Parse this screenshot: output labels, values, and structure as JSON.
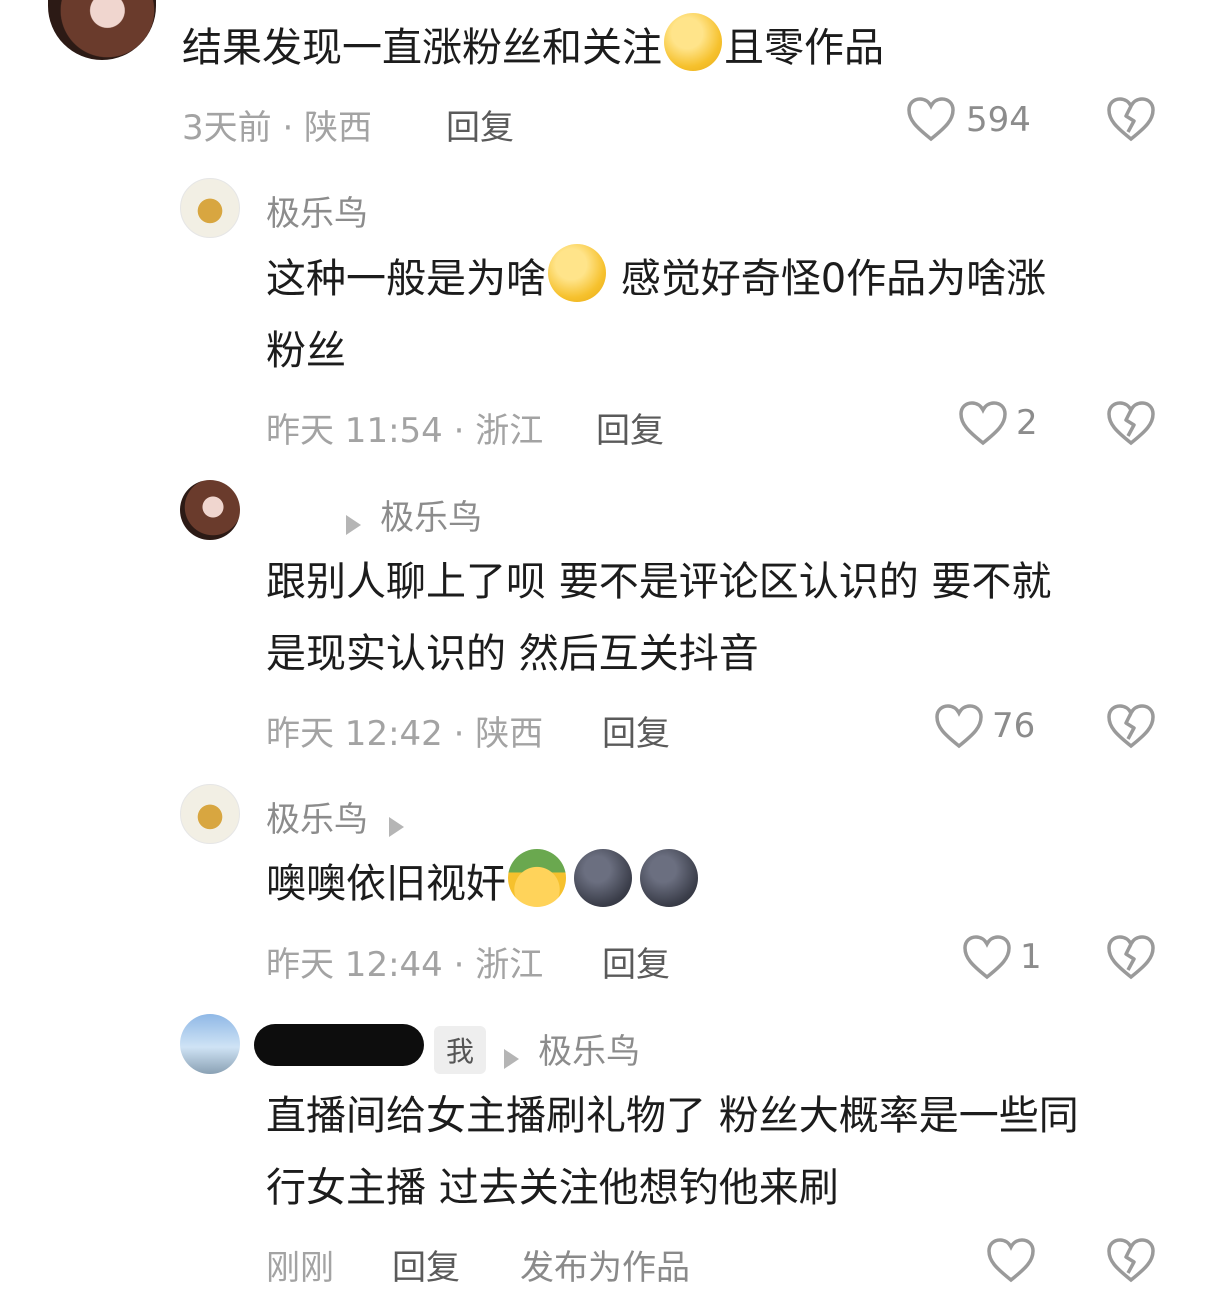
{
  "comments": [
    {
      "text": "结果发现一直涨粉丝和关注",
      "text_after_emoji": "且零作品",
      "meta": "3天前 · 陕西",
      "reply_label": "回复",
      "likes": "594"
    },
    {
      "username": "极乐鸟",
      "text": "这种一般是为啥",
      "text_after_emoji": " 感觉好奇怪0作品为啥涨",
      "text_line2": "粉丝",
      "meta": "昨天 11:54 · 浙江",
      "reply_label": "回复",
      "likes": "2"
    },
    {
      "reply_to": "极乐鸟",
      "text": "跟别人聊上了呗 要不是评论区认识的 要不就",
      "text_line2": "是现实认识的 然后互关抖音",
      "meta": "昨天 12:42 · 陕西",
      "reply_label": "回复",
      "likes": "76"
    },
    {
      "username": "极乐鸟",
      "text": "噢噢依旧视奸",
      "meta": "昨天 12:44 · 浙江",
      "reply_label": "回复",
      "likes": "1"
    },
    {
      "badge": "我",
      "reply_to": "极乐鸟",
      "text": "直播间给女主播刷礼物了 粉丝大概率是一些同",
      "text_line2": "行女主播 过去关注他想钓他来刷",
      "meta": "刚刚",
      "reply_label": "回复",
      "extra_action": "发布为作品"
    }
  ],
  "icons": {
    "like": "heart-outline-icon",
    "dislike": "broken-heart-icon",
    "reply_arrow": "play-arrow-icon"
  }
}
